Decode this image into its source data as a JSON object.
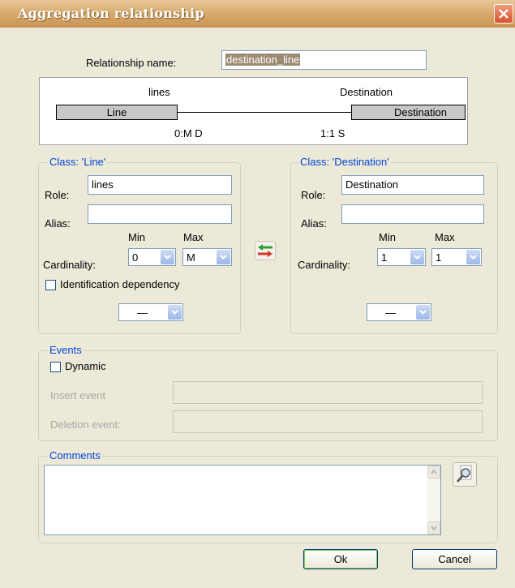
{
  "window": {
    "title": "Aggregation relationship"
  },
  "relationship_name": {
    "label": "Relationship name:",
    "value": "destination_line"
  },
  "diagram": {
    "left_role": "lines",
    "right_role": "Destination",
    "left_box": "Line",
    "right_box": "Destination",
    "left_cardinality": "0:M D",
    "right_cardinality": "1:1 S"
  },
  "class_left": {
    "legend": "Class: 'Line'",
    "role_label": "Role:",
    "role_value": "lines",
    "alias_label": "Alias:",
    "alias_value": "",
    "min_label": "Min",
    "max_label": "Max",
    "cardinality_label": "Cardinality:",
    "min_value": "0",
    "max_value": "M",
    "ident_dep_label": "Identification dependency",
    "extra_select_value": "—"
  },
  "class_right": {
    "legend": "Class: 'Destination'",
    "role_label": "Role:",
    "role_value": "Destination",
    "alias_label": "Alias:",
    "alias_value": "",
    "min_label": "Min",
    "max_label": "Max",
    "cardinality_label": "Cardinality:",
    "min_value": "1",
    "max_value": "1",
    "extra_select_value": "—"
  },
  "events": {
    "legend": "Events",
    "dynamic_label": "Dynamic",
    "insert_label": "Insert event",
    "deletion_label": "Deletion event:"
  },
  "comments": {
    "legend": "Comments",
    "value": ""
  },
  "buttons": {
    "ok": "Ok",
    "cancel": "Cancel"
  },
  "icons": {
    "close": "close-icon",
    "swap": "swap-arrows-icon",
    "zoom": "magnifier-icon"
  },
  "colors": {
    "title_bar": "#d9ac70",
    "group_legend": "#0046d5",
    "dialog_bg": "#ece9d8"
  }
}
